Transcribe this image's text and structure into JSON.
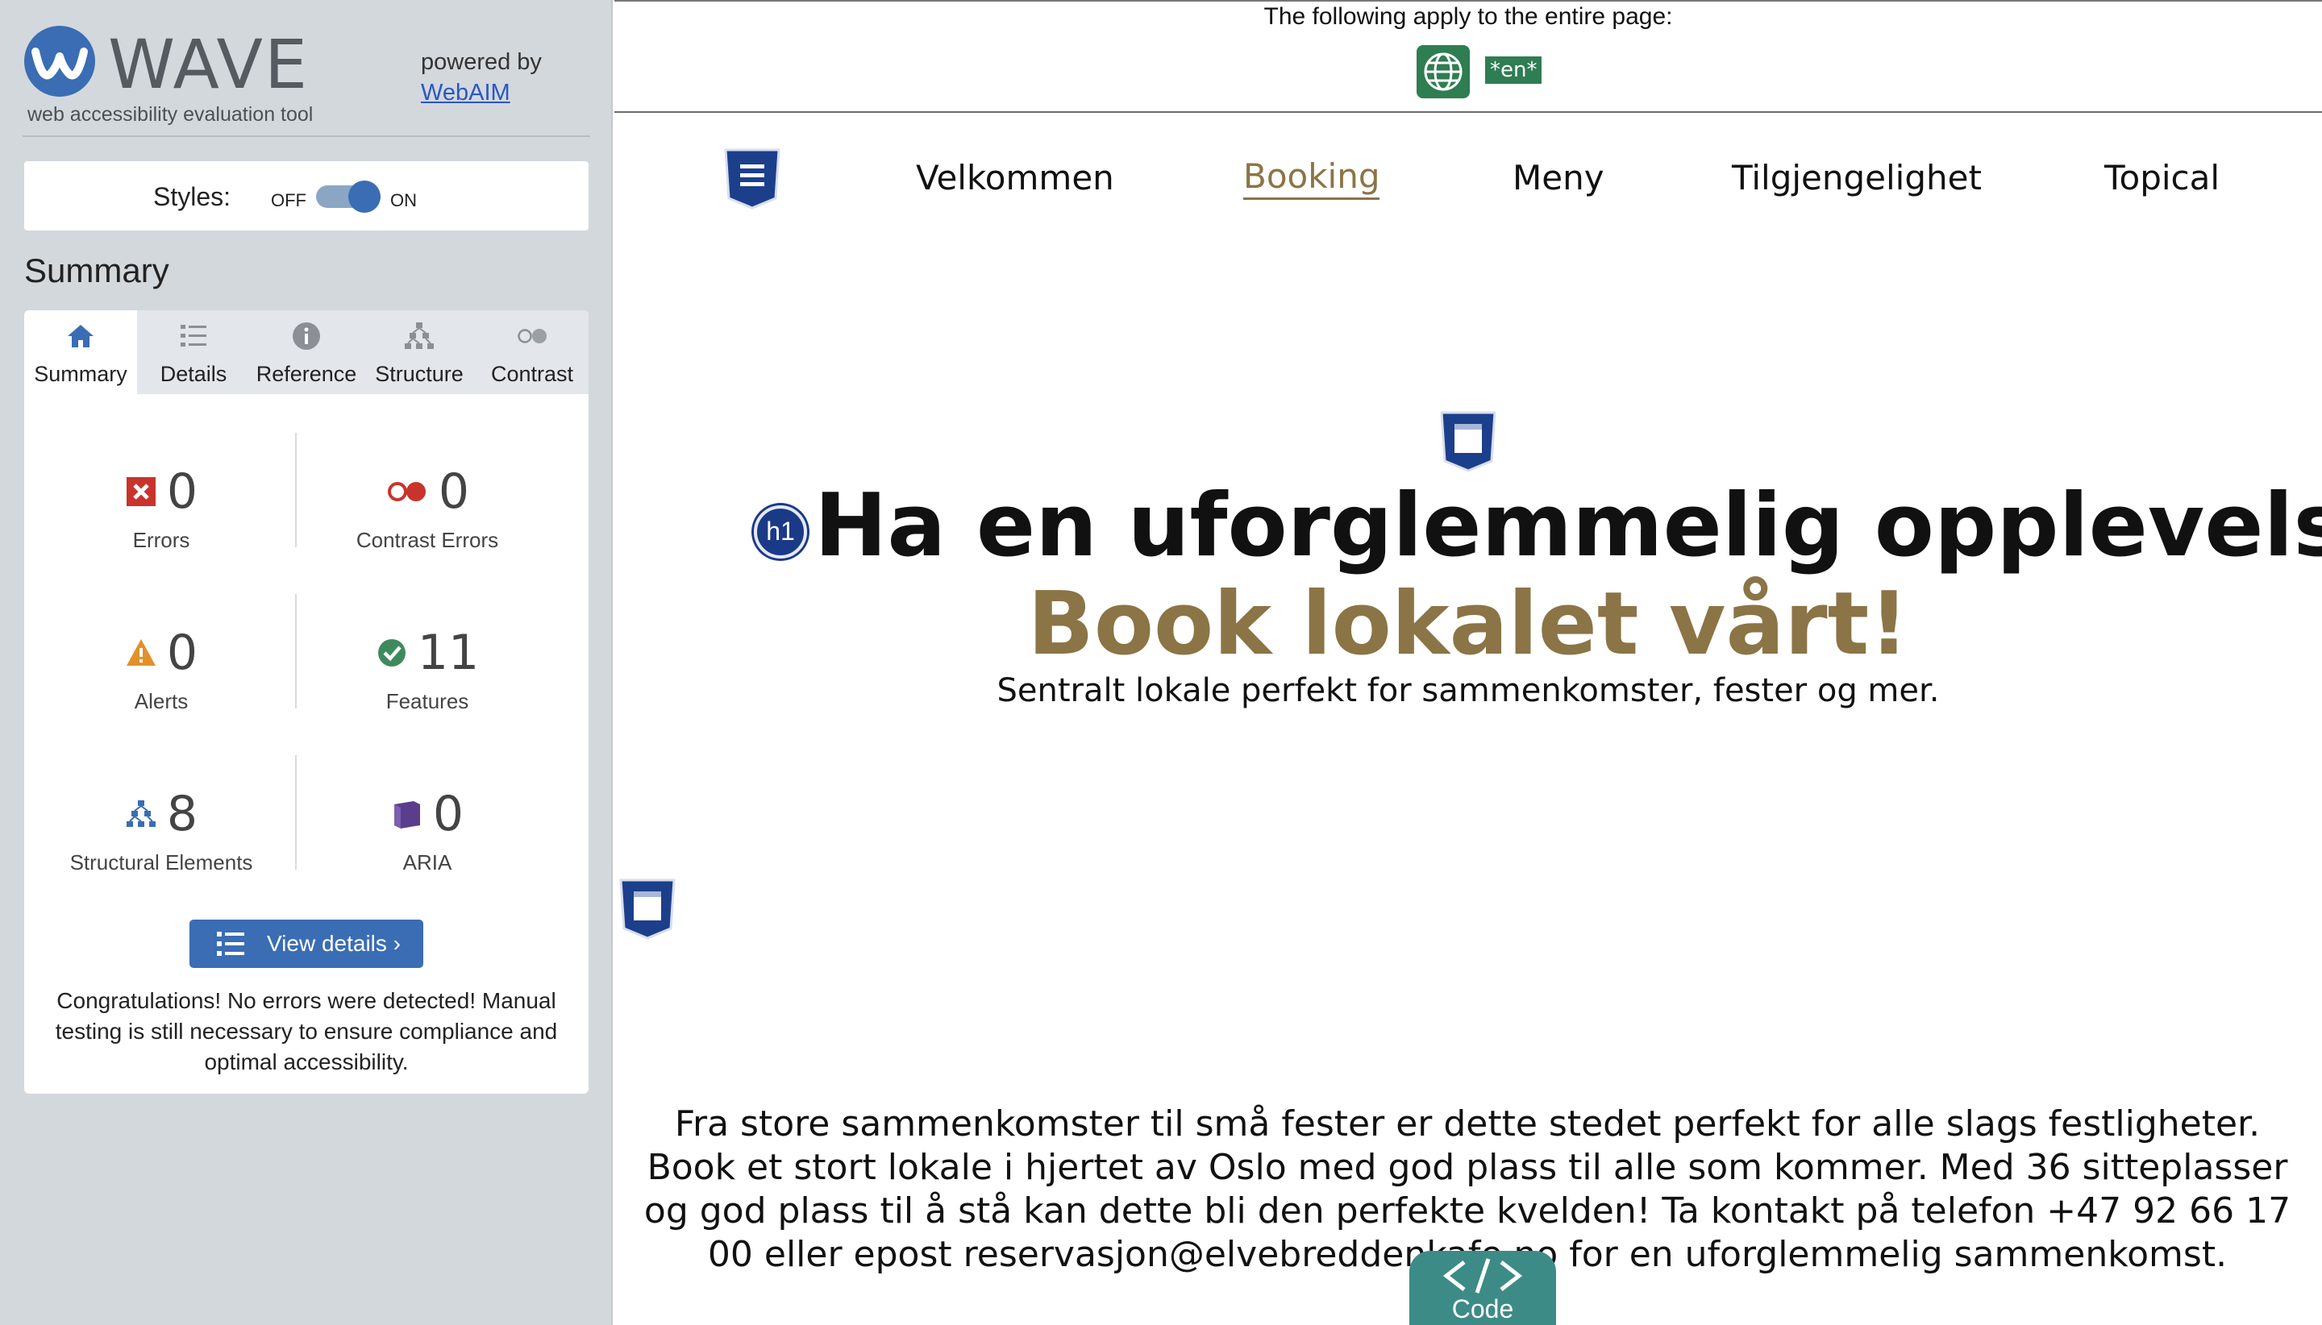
{
  "wave": {
    "name": "WAVE",
    "tagline": "web accessibility evaluation tool",
    "powered_by": "powered by",
    "webaim_link": "WebAIM",
    "styles_label": "Styles:",
    "styles_off": "OFF",
    "styles_on": "ON",
    "summary_heading": "Summary",
    "tabs": [
      {
        "label": "Summary",
        "icon": "home-icon",
        "active": true
      },
      {
        "label": "Details",
        "icon": "list-icon",
        "active": false
      },
      {
        "label": "Reference",
        "icon": "info-icon",
        "active": false
      },
      {
        "label": "Structure",
        "icon": "hierarchy-icon",
        "active": false
      },
      {
        "label": "Contrast",
        "icon": "contrast-icon",
        "active": false
      }
    ],
    "stats": {
      "errors": {
        "value": "0",
        "label": "Errors",
        "color": "#c8342c"
      },
      "contrast_errors": {
        "value": "0",
        "label": "Contrast Errors",
        "color": "#c8342c"
      },
      "alerts": {
        "value": "0",
        "label": "Alerts",
        "color": "#e2902a"
      },
      "features": {
        "value": "11",
        "label": "Features",
        "color": "#3f8a5c"
      },
      "structural": {
        "value": "8",
        "label": "Structural Elements",
        "color": "#3a6db3"
      },
      "aria": {
        "value": "0",
        "label": "ARIA",
        "color": "#5a3e8c"
      }
    },
    "view_details": "View details ›",
    "congrats": "Congratulations! No errors were detected! Manual testing is still necessary to ensure compliance and optimal accessibility."
  },
  "page": {
    "notice": "The following apply to the entire page:",
    "lang_badge": "*en*",
    "nav": [
      "Velkommen",
      "Booking",
      "Meny",
      "Tilgjengelighet",
      "Topical"
    ],
    "nav_active": "Booking",
    "hero_h1_badge": "h1",
    "hero_title": "Ha en uforglemmelig opplevelse.",
    "hero_sub": "Book lokalet vårt!",
    "hero_lead": "Sentralt lokale perfekt for sammenkomster, fester og mer.",
    "body_lines": [
      "Fra store sammenkomster til små fester er dette stedet perfekt for alle slags festligheter.",
      "Book et stort lokale i hjertet av Oslo med god plass til alle som kommer. Med 36 sitteplasser",
      "og god plass til å stå kan dette bli den perfekte kvelden! Ta kontakt på telefon +47 92 66 17",
      "00 eller epost reservasjon@elvebreddenkafe.no for en uforglemmelig sammenkomst."
    ],
    "code_label": "Code"
  },
  "colors": {
    "sidebar_bg": "#d3d8dd",
    "accent_blue": "#3a6db3",
    "brand_gold": "#8b7446",
    "code_teal": "#3d8b86",
    "lang_green": "#2f7d52"
  }
}
